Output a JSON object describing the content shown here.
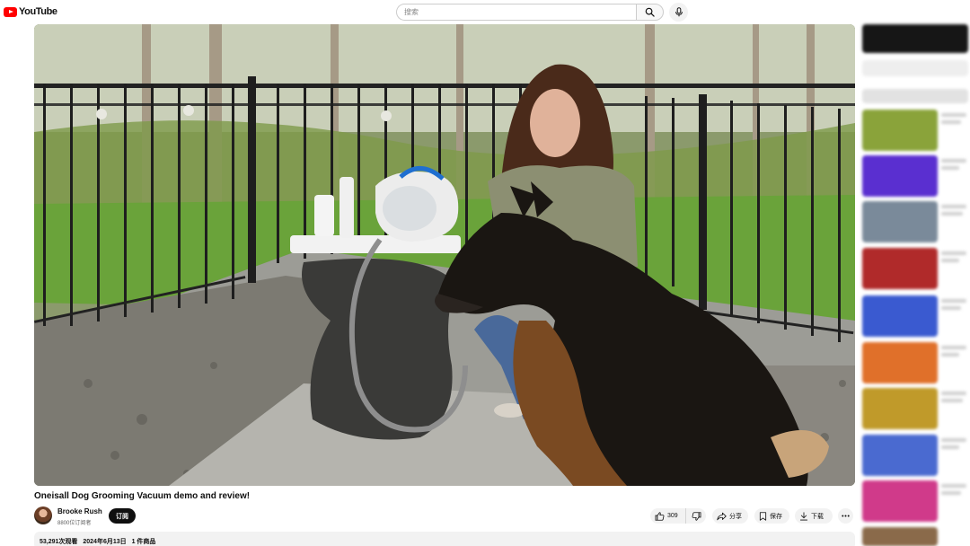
{
  "app": {
    "logo_text": "YouTube",
    "brand_color": "#ff0000"
  },
  "search": {
    "placeholder": "搜索",
    "search_icon": "search-icon",
    "mic_icon": "mic-icon"
  },
  "video": {
    "title": "Oneisall Dog Grooming Vacuum demo and review!",
    "channel_name": "Brooke Rush",
    "subscribers": "8800位订阅者",
    "subscribe_label": "订阅",
    "like_count": "309",
    "share_label": "分享",
    "save_label": "保存",
    "download_label": "下载",
    "views": "53,291次观看",
    "date": "2024年6月13日",
    "products": "1 件商品"
  },
  "sidebar": {
    "thumb_colors": [
      "#1a1a1a",
      "#e8e0d8",
      "#d8d8d8",
      "#8aa33a",
      "#5a2fd0",
      "#7a8a9a",
      "#b02a2a",
      "#3a5ad0",
      "#e0702a",
      "#c09a2a",
      "#4a6ad0",
      "#d03a8a",
      "#8a6a4a"
    ]
  }
}
